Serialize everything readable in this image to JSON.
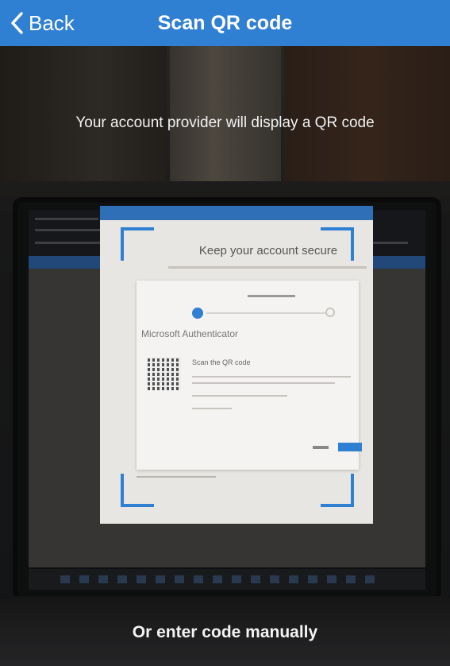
{
  "navbar": {
    "back_label": "Back",
    "title": "Scan QR code",
    "color": "#2f7fd3"
  },
  "camera": {
    "instruction": "Your account provider will display a QR code",
    "scanned_page": {
      "heading": "Keep your account secure",
      "dialog_title": "Microsoft Authenticator",
      "dialog_scan_title": "Scan the QR code"
    }
  },
  "footer": {
    "manual_entry_label": "Or enter code manually"
  }
}
